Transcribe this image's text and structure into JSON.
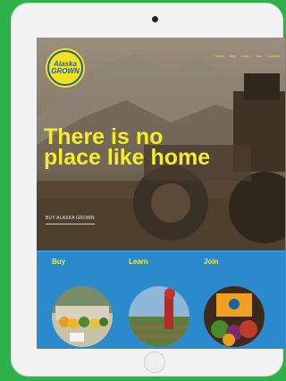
{
  "logo": {
    "line1": "Alaska",
    "line2": "GROWN"
  },
  "nav": {
    "items": [
      "Home",
      "Buy",
      "Learn",
      "Join",
      "Contact"
    ]
  },
  "hero": {
    "headline": "There is no place like home",
    "subtext": "BUY ALASKA GROWN"
  },
  "cards": [
    {
      "title": "Buy"
    },
    {
      "title": "Learn"
    },
    {
      "title": "Join"
    }
  ]
}
